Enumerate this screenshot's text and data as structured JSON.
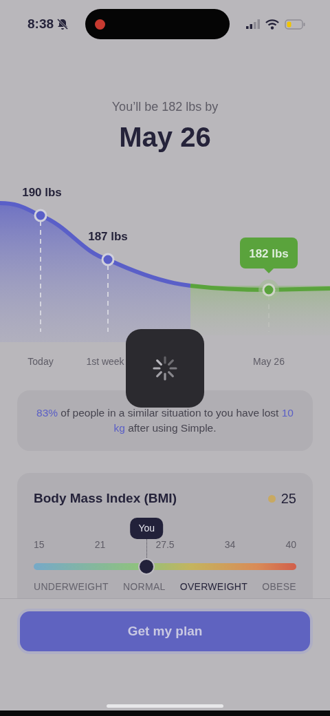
{
  "status_bar": {
    "time": "8:38",
    "silent": true,
    "recording": true
  },
  "header": {
    "subtitle": "You’ll be 182 lbs by",
    "title": "May 26"
  },
  "chart": {
    "points": [
      {
        "kind": "milestone",
        "value_label": "190 lbs",
        "x_label": "Today"
      },
      {
        "kind": "milestone",
        "value_label": "187 lbs",
        "x_label": "1st week"
      },
      {
        "kind": "goal",
        "value_label": "182 lbs",
        "x_label": "May 26"
      }
    ]
  },
  "loading": true,
  "stat": {
    "parts": [
      {
        "text": "83%",
        "highlight": true
      },
      {
        "text": " of people in a similar situation to you have lost ",
        "highlight": false
      },
      {
        "text": "10 kg",
        "highlight": true
      },
      {
        "text": " after using Simple.",
        "highlight": false
      }
    ]
  },
  "bmi": {
    "title": "Body Mass Index (BMI)",
    "value": "25",
    "color": "#c8a962",
    "marker": "You",
    "level": 0.43,
    "ticks": [
      "15",
      "21",
      "27.5",
      "34",
      "40"
    ],
    "categories": [
      {
        "label": "UNDERWEIGHT",
        "selected": false
      },
      {
        "label": "NORMAL",
        "selected": false
      },
      {
        "label": "OVERWEIGHT",
        "selected": true
      },
      {
        "label": "OBESE",
        "selected": false
      }
    ]
  },
  "button": {
    "label": "Get my plan"
  }
}
